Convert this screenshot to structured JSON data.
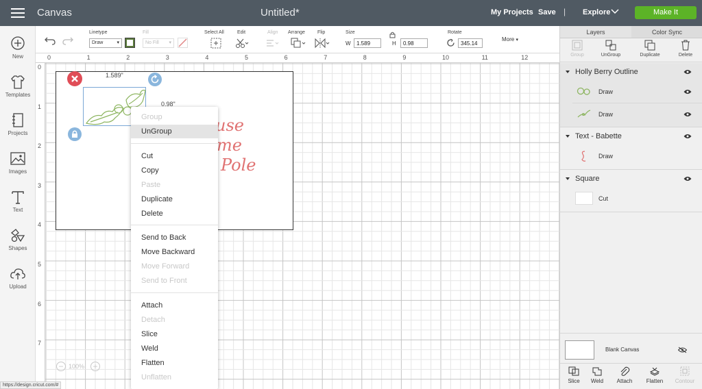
{
  "topbar": {
    "app_title": "Canvas",
    "doc_title": "Untitled*",
    "my_projects": "My Projects",
    "save": "Save",
    "separator": "|",
    "explore": "Explore",
    "make_it": "Make It",
    "make_it_color": "#5cb327",
    "bar_color": "#505a63"
  },
  "leftnav": {
    "items": [
      {
        "label": "New",
        "icon": "plus-circle-icon"
      },
      {
        "label": "Templates",
        "icon": "tshirt-icon"
      },
      {
        "label": "Projects",
        "icon": "notebook-icon"
      },
      {
        "label": "Images",
        "icon": "image-icon"
      },
      {
        "label": "Text",
        "icon": "text-icon"
      },
      {
        "label": "Shapes",
        "icon": "shapes-icon"
      },
      {
        "label": "Upload",
        "icon": "upload-icon"
      }
    ]
  },
  "toolbar": {
    "linetype_label": "Linetype",
    "linetype_value": "Draw",
    "fill_label": "Fill",
    "fill_value": "No Fill",
    "select_all_label": "Select All",
    "edit_label": "Edit",
    "align_label": "Align",
    "arrange_label": "Arrange",
    "flip_label": "Flip",
    "size_label": "Size",
    "w_label": "W",
    "w_value": "1.589",
    "h_label": "H",
    "h_value": "0.98",
    "rotate_label": "Rotate",
    "rotate_value": "345.14",
    "more_label": "More"
  },
  "rulers": {
    "top": [
      "0",
      "1",
      "2",
      "3",
      "4",
      "5",
      "6",
      "7",
      "8",
      "9",
      "10",
      "11",
      "12"
    ],
    "left": [
      "0",
      "1",
      "2",
      "3",
      "4",
      "5",
      "6",
      "7"
    ]
  },
  "selection": {
    "width_label": "1.589\"",
    "height_label": "0.98\""
  },
  "canvas_text": {
    "line1": "use",
    "line2": "me",
    "line3": "Pole"
  },
  "zoom": {
    "value": "100%",
    "minus": "−",
    "plus": "+"
  },
  "context_menu": {
    "items": [
      {
        "label": "Group",
        "enabled": false
      },
      {
        "label": "UnGroup",
        "enabled": true,
        "highlighted": true
      },
      {
        "label": "Cut",
        "enabled": true
      },
      {
        "label": "Copy",
        "enabled": true
      },
      {
        "label": "Paste",
        "enabled": false
      },
      {
        "label": "Duplicate",
        "enabled": true
      },
      {
        "label": "Delete",
        "enabled": true
      },
      {
        "label": "Send to Back",
        "enabled": true
      },
      {
        "label": "Move Backward",
        "enabled": true
      },
      {
        "label": "Move Forward",
        "enabled": false
      },
      {
        "label": "Send to Front",
        "enabled": false
      },
      {
        "label": "Attach",
        "enabled": true
      },
      {
        "label": "Detach",
        "enabled": false
      },
      {
        "label": "Slice",
        "enabled": true
      },
      {
        "label": "Weld",
        "enabled": true
      },
      {
        "label": "Flatten",
        "enabled": true
      },
      {
        "label": "Unflatten",
        "enabled": false
      }
    ]
  },
  "right_panel": {
    "tabs": [
      "Layers",
      "Color Sync"
    ],
    "actions": [
      {
        "label": "Group",
        "enabled": false
      },
      {
        "label": "UnGroup",
        "enabled": true
      },
      {
        "label": "Duplicate",
        "enabled": true
      },
      {
        "label": "Delete",
        "enabled": true
      }
    ],
    "groups": [
      {
        "name": "Holly Berry Outline",
        "rows": [
          "Draw",
          "Draw"
        ]
      },
      {
        "name": "Text - Babette",
        "rows": [
          "Draw"
        ]
      },
      {
        "name": "Square",
        "rows": [
          "Cut"
        ]
      }
    ],
    "blank_canvas": "Blank Canvas",
    "bottom_actions": [
      {
        "label": "Slice",
        "enabled": true
      },
      {
        "label": "Weld",
        "enabled": true
      },
      {
        "label": "Attach",
        "enabled": true
      },
      {
        "label": "Flatten",
        "enabled": true
      },
      {
        "label": "Contour",
        "enabled": false
      }
    ]
  },
  "status_url": "https://design.cricut.com/#"
}
